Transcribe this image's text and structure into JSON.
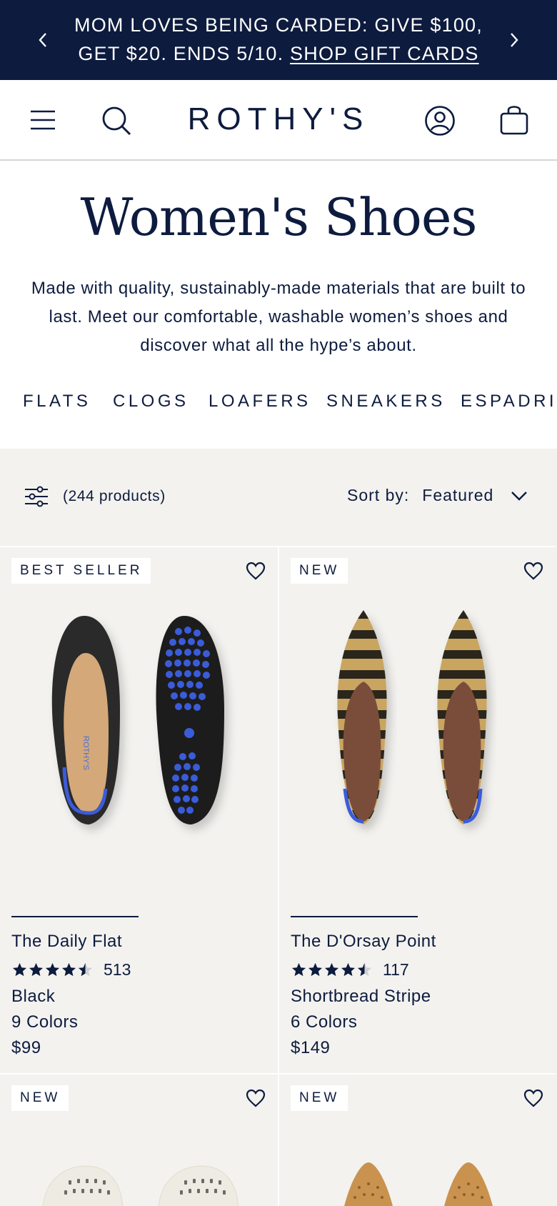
{
  "promo": {
    "text": "MOM LOVES BEING CARDED: GIVE $100, GET $20. ENDS 5/10.",
    "link_label": "SHOP GIFT CARDS",
    "prev_icon": "chevron-left-icon",
    "next_icon": "chevron-right-icon",
    "bg_color": "#0d1b3e"
  },
  "header": {
    "logo": "ROTHY'S",
    "icons": [
      "menu-icon",
      "search-icon",
      "account-icon",
      "cart-icon"
    ]
  },
  "page": {
    "title": "Women's Shoes",
    "description": "Made with quality, sustainably-made materials that are built to last. Meet our comfortable, washable women’s shoes and discover what all the hype’s about."
  },
  "categories": [
    "FLATS",
    "CLOGS",
    "LOAFERS",
    "SNEAKERS",
    "ESPADRILLES"
  ],
  "filter": {
    "count_label": "(244 products)",
    "sort_label": "Sort by:",
    "sort_value": "Featured"
  },
  "products": [
    {
      "badge": "BEST SELLER",
      "name": "The Daily Flat",
      "rating": 4.5,
      "reviews": "513",
      "color": "Black",
      "colors": "9 Colors",
      "price": "$99"
    },
    {
      "badge": "NEW",
      "name": "The D'Orsay Point",
      "rating": 4.5,
      "reviews": "117",
      "color": "Shortbread Stripe",
      "colors": "6 Colors",
      "price": "$149"
    },
    {
      "badge": "NEW"
    },
    {
      "badge": "NEW"
    }
  ],
  "colors": {
    "navy": "#0d1b3e",
    "listing_bg": "#f3f2ef",
    "accent_blue": "#3b5bd9"
  }
}
